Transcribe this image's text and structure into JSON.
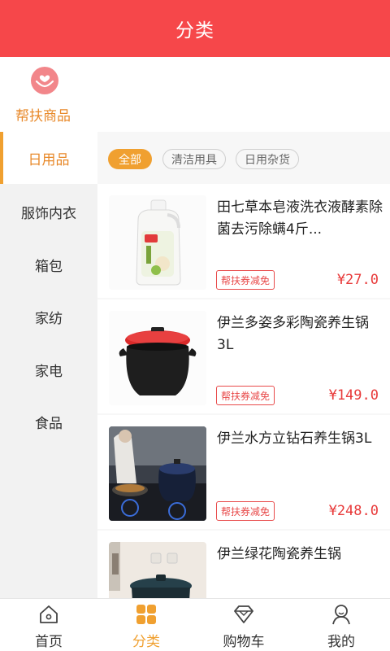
{
  "header": {
    "title": "分类"
  },
  "featured": {
    "label": "帮扶商品",
    "icon": "helping-hands-icon",
    "color": "#e8892a"
  },
  "sidebar": {
    "items": [
      {
        "label": "日用品",
        "active": true
      },
      {
        "label": "服饰内衣"
      },
      {
        "label": "箱包"
      },
      {
        "label": "家纺"
      },
      {
        "label": "家电"
      },
      {
        "label": "食品"
      }
    ]
  },
  "filters": {
    "chips": [
      {
        "label": "全部",
        "active": true
      },
      {
        "label": "清洁用具"
      },
      {
        "label": "日用杂货"
      }
    ]
  },
  "products": [
    {
      "name": "田七草本皂液洗衣液酵素除菌去污除螨4斤...",
      "badge": "帮扶券减免",
      "price": "¥27.0",
      "image": "detergent-bottle"
    },
    {
      "name": "伊兰多姿多彩陶瓷养生锅3L",
      "badge": "帮扶券减免",
      "price": "¥149.0",
      "image": "red-lid-casserole"
    },
    {
      "name": "伊兰水方立钻石养生锅3L",
      "badge": "帮扶券减免",
      "price": "¥248.0",
      "image": "kitchen-cooking-photo"
    },
    {
      "name": "伊兰绿花陶瓷养生锅",
      "badge": "",
      "price": "",
      "image": "green-pot-photo"
    }
  ],
  "tabbar": {
    "items": [
      {
        "label": "首页",
        "icon": "home-icon"
      },
      {
        "label": "分类",
        "icon": "category-grid-icon",
        "active": true
      },
      {
        "label": "购物车",
        "icon": "diamond-cart-icon"
      },
      {
        "label": "我的",
        "icon": "user-icon"
      }
    ]
  },
  "colors": {
    "header": "#f6474a",
    "accent": "#f0a030",
    "price": "#e83a3a"
  }
}
